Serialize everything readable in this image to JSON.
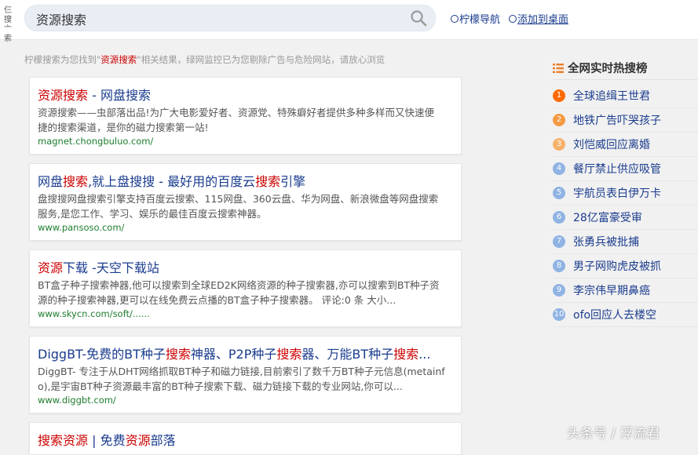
{
  "header": {
    "logo_line1": "仨 搜",
    "logo_line2": "亠 索",
    "search_value": "资源搜索",
    "nav_link": "柠檬导航",
    "add_desktop_link": "添加到桌面"
  },
  "notice": {
    "prefix": "柠檬搜索为您找到\"",
    "keyword": "资源搜索",
    "suffix": "\"相关结果，绿网监控已为您剔除广告与危险网站，请放心浏览"
  },
  "results": [
    {
      "title_parts": [
        {
          "text": "资源搜索",
          "hl": true
        },
        {
          "text": " - 网盘搜索",
          "hl": false
        }
      ],
      "desc_line1": "资源搜索——虫部落出品!为广大电影爱好者、资源党、特殊癖好者提供多种多样而又快速便",
      "desc_line2": "捷的搜索渠道，是你的磁力搜索第一站!",
      "url": "magnet.chongbuluo.com/"
    },
    {
      "title_parts": [
        {
          "text": "网盘",
          "hl": false
        },
        {
          "text": "搜索",
          "hl": true
        },
        {
          "text": ",就上盘搜搜 - 最好用的百度云",
          "hl": false
        },
        {
          "text": "搜索",
          "hl": true
        },
        {
          "text": "引擎",
          "hl": false
        }
      ],
      "desc_line1": "盘搜搜网盘搜索引擎支持百度云搜索、115网盘、360云盘、华为网盘、新浪微盘等网盘搜索",
      "desc_line2": "服务,是您工作、学习、娱乐的最佳百度云搜索神器。",
      "url": "www.pansoso.com/"
    },
    {
      "title_parts": [
        {
          "text": "资源",
          "hl": true
        },
        {
          "text": "下载 -天空下载站",
          "hl": false
        }
      ],
      "desc_line1": "BT盒子种子搜索神器,他可以搜索到全球ED2K网络资源的种子搜索器,亦可以搜索到BT种子资",
      "desc_line2": "源的种子搜索神器,更可以在线免费云点播的BT盒子种子搜索器。 评论:0 条 大小...",
      "url": "www.skycn.com/soft/......"
    },
    {
      "title_parts": [
        {
          "text": "DiggBT-免费的BT种子",
          "hl": false
        },
        {
          "text": "搜索",
          "hl": true
        },
        {
          "text": "神器、P2P种子",
          "hl": false
        },
        {
          "text": "搜索",
          "hl": true
        },
        {
          "text": "器、万能BT种子",
          "hl": false
        },
        {
          "text": "搜索",
          "hl": true
        },
        {
          "text": "...",
          "hl": false
        }
      ],
      "desc_line1": "DiggBT- 专注于从DHT网络抓取BT种子和磁力链接,目前索引了数千万BT种子元信息(metainf",
      "desc_line2": "o),是宇宙BT种子资源最丰富的BT种子搜索下载、磁力链接下载的专业网站,你可以...",
      "url": "www.diggbt.com/"
    },
    {
      "title_parts": [
        {
          "text": "搜索资源",
          "hl": true
        },
        {
          "text": " | 免费",
          "hl": false
        },
        {
          "text": "资源",
          "hl": true
        },
        {
          "text": "部落",
          "hl": false
        }
      ],
      "desc_line1": "",
      "desc_line2": "",
      "url": ""
    }
  ],
  "sidebar": {
    "title": "全网实时热搜榜",
    "items": [
      {
        "num": "1",
        "label": "全球追缉王世君",
        "color": "#ff6a00"
      },
      {
        "num": "2",
        "label": "地铁广告吓哭孩子",
        "color": "#f59a42"
      },
      {
        "num": "3",
        "label": "刘恺威回应离婚",
        "color": "#f6b26b"
      },
      {
        "num": "4",
        "label": "餐厅禁止供应吸管",
        "color": "#8fb3e3"
      },
      {
        "num": "5",
        "label": "宇航员表白伊万卡",
        "color": "#8fb3e3"
      },
      {
        "num": "6",
        "label": "28亿富豪受审",
        "color": "#8fb3e3"
      },
      {
        "num": "7",
        "label": "张勇兵被批捕",
        "color": "#8fb3e3"
      },
      {
        "num": "8",
        "label": "男子网购虎皮被抓",
        "color": "#8fb3e3"
      },
      {
        "num": "9",
        "label": "李宗伟早期鼻癌",
        "color": "#8fb3e3"
      },
      {
        "num": "10",
        "label": "ofo回应人去楼空",
        "color": "#8fb3e3"
      }
    ]
  },
  "watermark": "头条号 / 浮流君"
}
